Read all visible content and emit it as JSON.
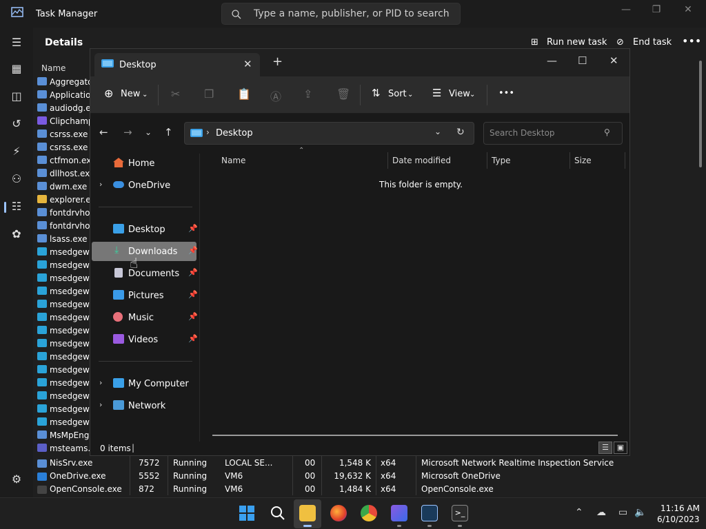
{
  "task_manager": {
    "title": "Task Manager",
    "search_placeholder": "Type a name, publisher, or PID to search",
    "section": "Details",
    "run_new_task": "Run new task",
    "end_task": "End task",
    "col_name": "Name",
    "processes": [
      {
        "name": "Aggregator",
        "color": "#5a8fd6"
      },
      {
        "name": "Application",
        "color": "#5a8fd6"
      },
      {
        "name": "audiodg.exe",
        "color": "#5a8fd6"
      },
      {
        "name": "Clipchamp",
        "color": "#7a5ae0"
      },
      {
        "name": "csrss.exe",
        "color": "#5a8fd6"
      },
      {
        "name": "csrss.exe",
        "color": "#5a8fd6"
      },
      {
        "name": "ctfmon.exe",
        "color": "#5a8fd6"
      },
      {
        "name": "dllhost.exe",
        "color": "#5a8fd6"
      },
      {
        "name": "dwm.exe",
        "color": "#5a8fd6"
      },
      {
        "name": "explorer.exe",
        "color": "#e6b53d"
      },
      {
        "name": "fontdrvhos",
        "color": "#5a8fd6"
      },
      {
        "name": "fontdrvhos",
        "color": "#5a8fd6"
      },
      {
        "name": "lsass.exe",
        "color": "#5a8fd6"
      },
      {
        "name": "msedgewe",
        "color": "#2aa3d8"
      },
      {
        "name": "msedgewe",
        "color": "#2aa3d8"
      },
      {
        "name": "msedgewe",
        "color": "#2aa3d8"
      },
      {
        "name": "msedgewe",
        "color": "#2aa3d8"
      },
      {
        "name": "msedgewe",
        "color": "#2aa3d8"
      },
      {
        "name": "msedgewe",
        "color": "#2aa3d8"
      },
      {
        "name": "msedgewe",
        "color": "#2aa3d8"
      },
      {
        "name": "msedgewe",
        "color": "#2aa3d8"
      },
      {
        "name": "msedgewe",
        "color": "#2aa3d8"
      },
      {
        "name": "msedgewe",
        "color": "#2aa3d8"
      },
      {
        "name": "msedgewe",
        "color": "#2aa3d8"
      },
      {
        "name": "msedgewe",
        "color": "#2aa3d8"
      },
      {
        "name": "msedgewe",
        "color": "#2aa3d8"
      },
      {
        "name": "msedgewe",
        "color": "#2aa3d8"
      },
      {
        "name": "MsMpEng.",
        "color": "#5a8fd6"
      },
      {
        "name": "msteams.e",
        "color": "#5b5fc7"
      }
    ],
    "full_rows": [
      {
        "name": "NisSrv.exe",
        "pid": "7572",
        "status": "Running",
        "user": "LOCAL SE...",
        "cpu": "00",
        "mem": "1,548 K",
        "arch": "x64",
        "desc": "Microsoft Network Realtime Inspection Service",
        "color": "#5a8fd6"
      },
      {
        "name": "OneDrive.exe",
        "pid": "5552",
        "status": "Running",
        "user": "VM6",
        "cpu": "00",
        "mem": "19,632 K",
        "arch": "x64",
        "desc": "Microsoft OneDrive",
        "color": "#2a7fd8"
      },
      {
        "name": "OpenConsole.exe",
        "pid": "872",
        "status": "Running",
        "user": "VM6",
        "cpu": "00",
        "mem": "1,484 K",
        "arch": "x64",
        "desc": "OpenConsole.exe",
        "color": "#444444"
      }
    ]
  },
  "explorer": {
    "tab_title": "Desktop",
    "new_label": "New",
    "sort_label": "Sort",
    "view_label": "View",
    "more_label": "•••",
    "address": "Desktop",
    "search_placeholder": "Search Desktop",
    "nav": {
      "home": "Home",
      "onedrive": "OneDrive",
      "desktop": "Desktop",
      "downloads": "Downloads",
      "documents": "Documents",
      "pictures": "Pictures",
      "music": "Music",
      "videos": "Videos",
      "my_computer": "My Computer",
      "network": "Network"
    },
    "columns": {
      "name": "Name",
      "date": "Date modified",
      "type": "Type",
      "size": "Size"
    },
    "empty_message": "This folder is empty.",
    "status": "0 items"
  },
  "taskbar": {
    "time": "11:16 AM",
    "date": "6/10/2023"
  }
}
